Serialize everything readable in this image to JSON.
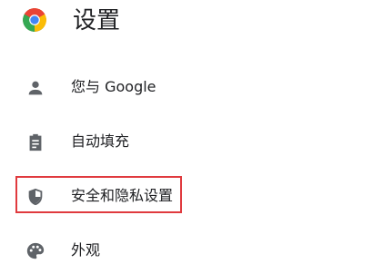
{
  "header": {
    "logo_icon": "chrome-logo-icon",
    "title": "设置"
  },
  "nav": {
    "items": [
      {
        "label": "您与 Google",
        "icon": "person-icon"
      },
      {
        "label": "自动填充",
        "icon": "clipboard-icon"
      },
      {
        "label": "安全和隐私设置",
        "icon": "shield-icon",
        "highlighted": true
      },
      {
        "label": "外观",
        "icon": "palette-icon"
      }
    ]
  },
  "colors": {
    "icon": "#5f6368",
    "text": "#202124",
    "highlight_border": "#e03a3e",
    "chrome_red": "#ea4335",
    "chrome_yellow": "#fbbc05",
    "chrome_green": "#34a853",
    "chrome_blue": "#4285f4"
  }
}
